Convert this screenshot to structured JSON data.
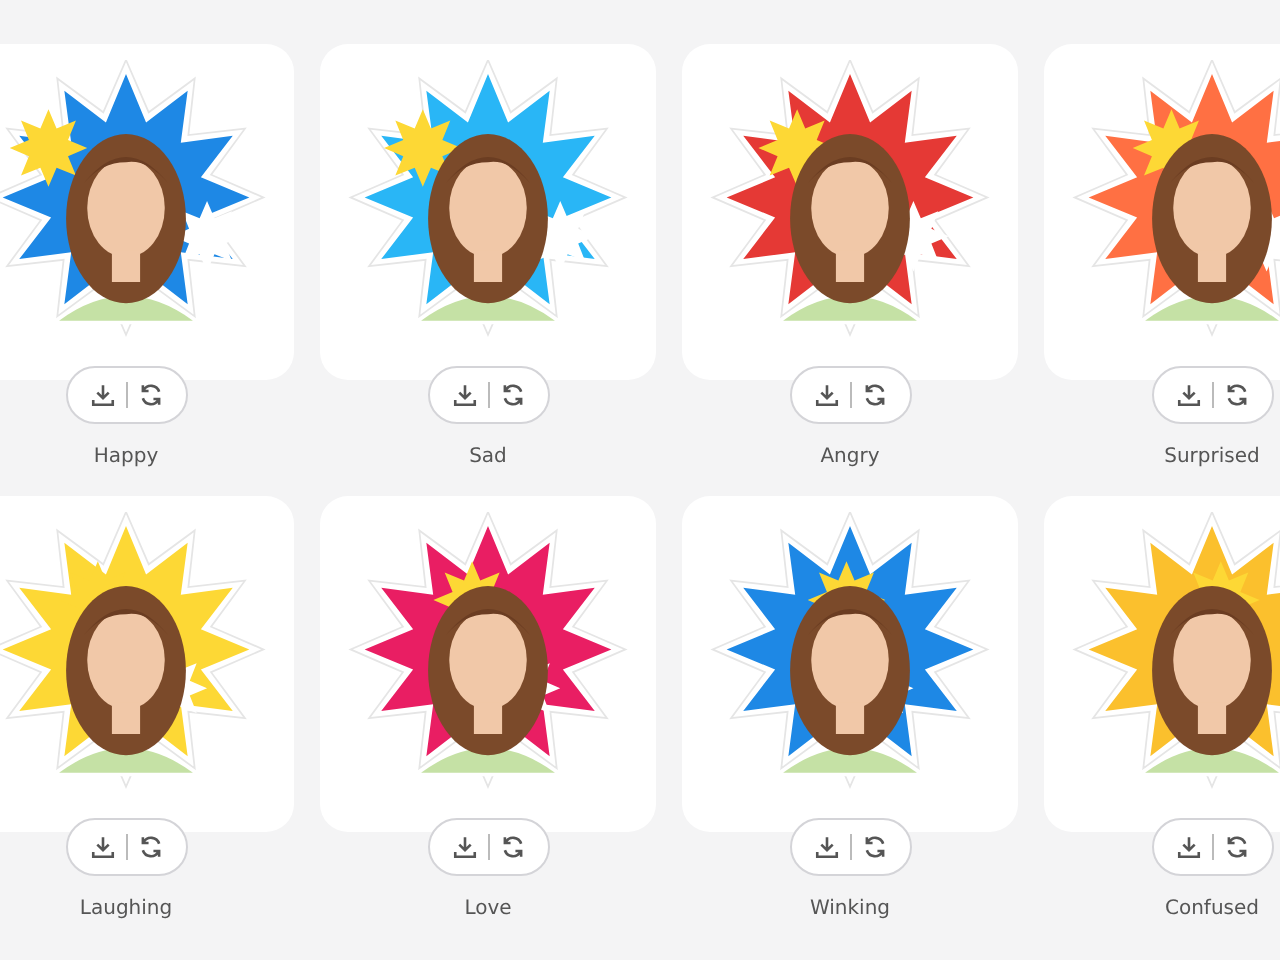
{
  "stickers": [
    {
      "label": "Happy"
    },
    {
      "label": "Sad"
    },
    {
      "label": "Angry"
    },
    {
      "label": "Surprised"
    },
    {
      "label": "Laughing"
    },
    {
      "label": "Love"
    },
    {
      "label": "Winking"
    },
    {
      "label": "Confused"
    }
  ]
}
